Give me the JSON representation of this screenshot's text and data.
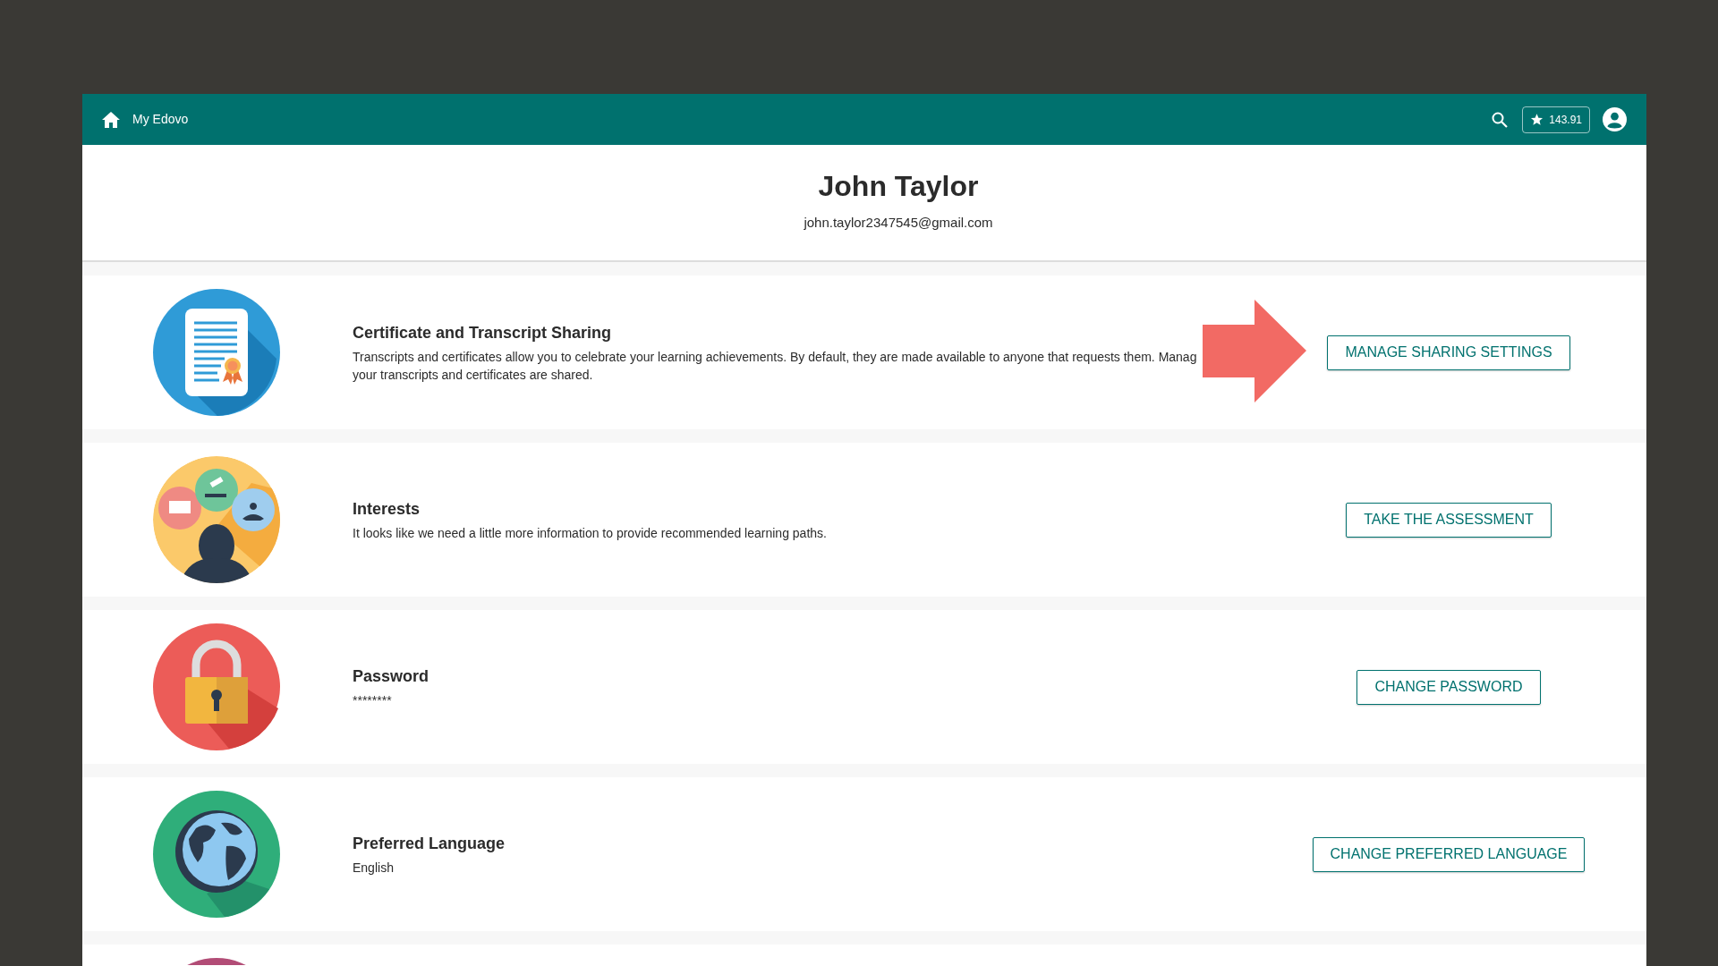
{
  "header": {
    "title": "My Edovo",
    "points": "143.91"
  },
  "profile": {
    "name": "John Taylor",
    "email": "john.taylor2347545@gmail.com"
  },
  "cards": [
    {
      "kind": "certificate",
      "title": "Certificate and Transcript Sharing",
      "lines": [
        "Transcripts and certificates allow you to celebrate your learning achievements. By default, they are made available to anyone that requests them. Manag",
        "your transcripts and certificates are shared."
      ],
      "button": "MANAGE SHARING SETTINGS",
      "arrow": true
    },
    {
      "kind": "interests",
      "title": "Interests",
      "lines": [
        "It looks like we need a little more information to provide recommended learning paths."
      ],
      "button": "TAKE THE ASSESSMENT",
      "arrow": false
    },
    {
      "kind": "lock",
      "title": "Password",
      "lines": [
        "********"
      ],
      "button": "CHANGE PASSWORD",
      "arrow": false
    },
    {
      "kind": "globe",
      "title": "Preferred Language",
      "lines": [
        "English"
      ],
      "button": "CHANGE PREFERRED LANGUAGE",
      "arrow": false
    },
    {
      "kind": "partial"
    }
  ]
}
